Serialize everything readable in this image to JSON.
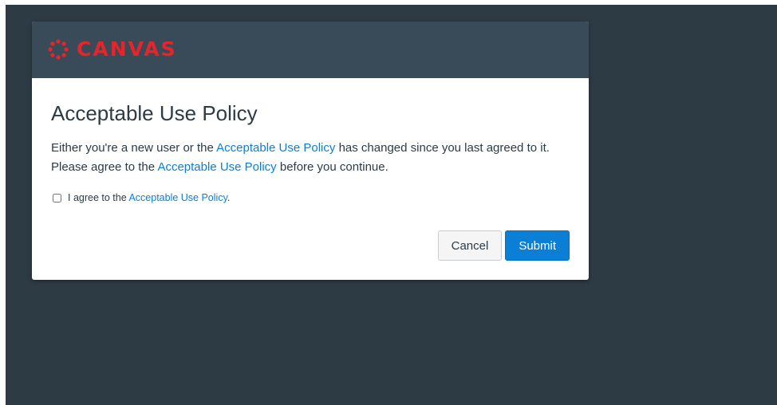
{
  "brand": {
    "name": "CANVAS",
    "logo_icon": "canvas-logo-icon",
    "color": "#e72429"
  },
  "dialog": {
    "title": "Acceptable Use Policy",
    "message": {
      "part1": "Either you're a new user or the ",
      "link1": "Acceptable Use Policy",
      "part2": " has changed since you last agreed to it. Please agree to the ",
      "link2": "Acceptable Use Policy",
      "part3": " before you continue."
    },
    "agreement": {
      "prefix": "I agree to the ",
      "link": "Acceptable Use Policy",
      "suffix": ".",
      "checked": false
    },
    "buttons": {
      "cancel": "Cancel",
      "submit": "Submit"
    }
  },
  "colors": {
    "page_background": "#2d3b45",
    "header_background": "#394b58",
    "link": "#0b7fd6",
    "primary_button": "#0b7fd6"
  }
}
